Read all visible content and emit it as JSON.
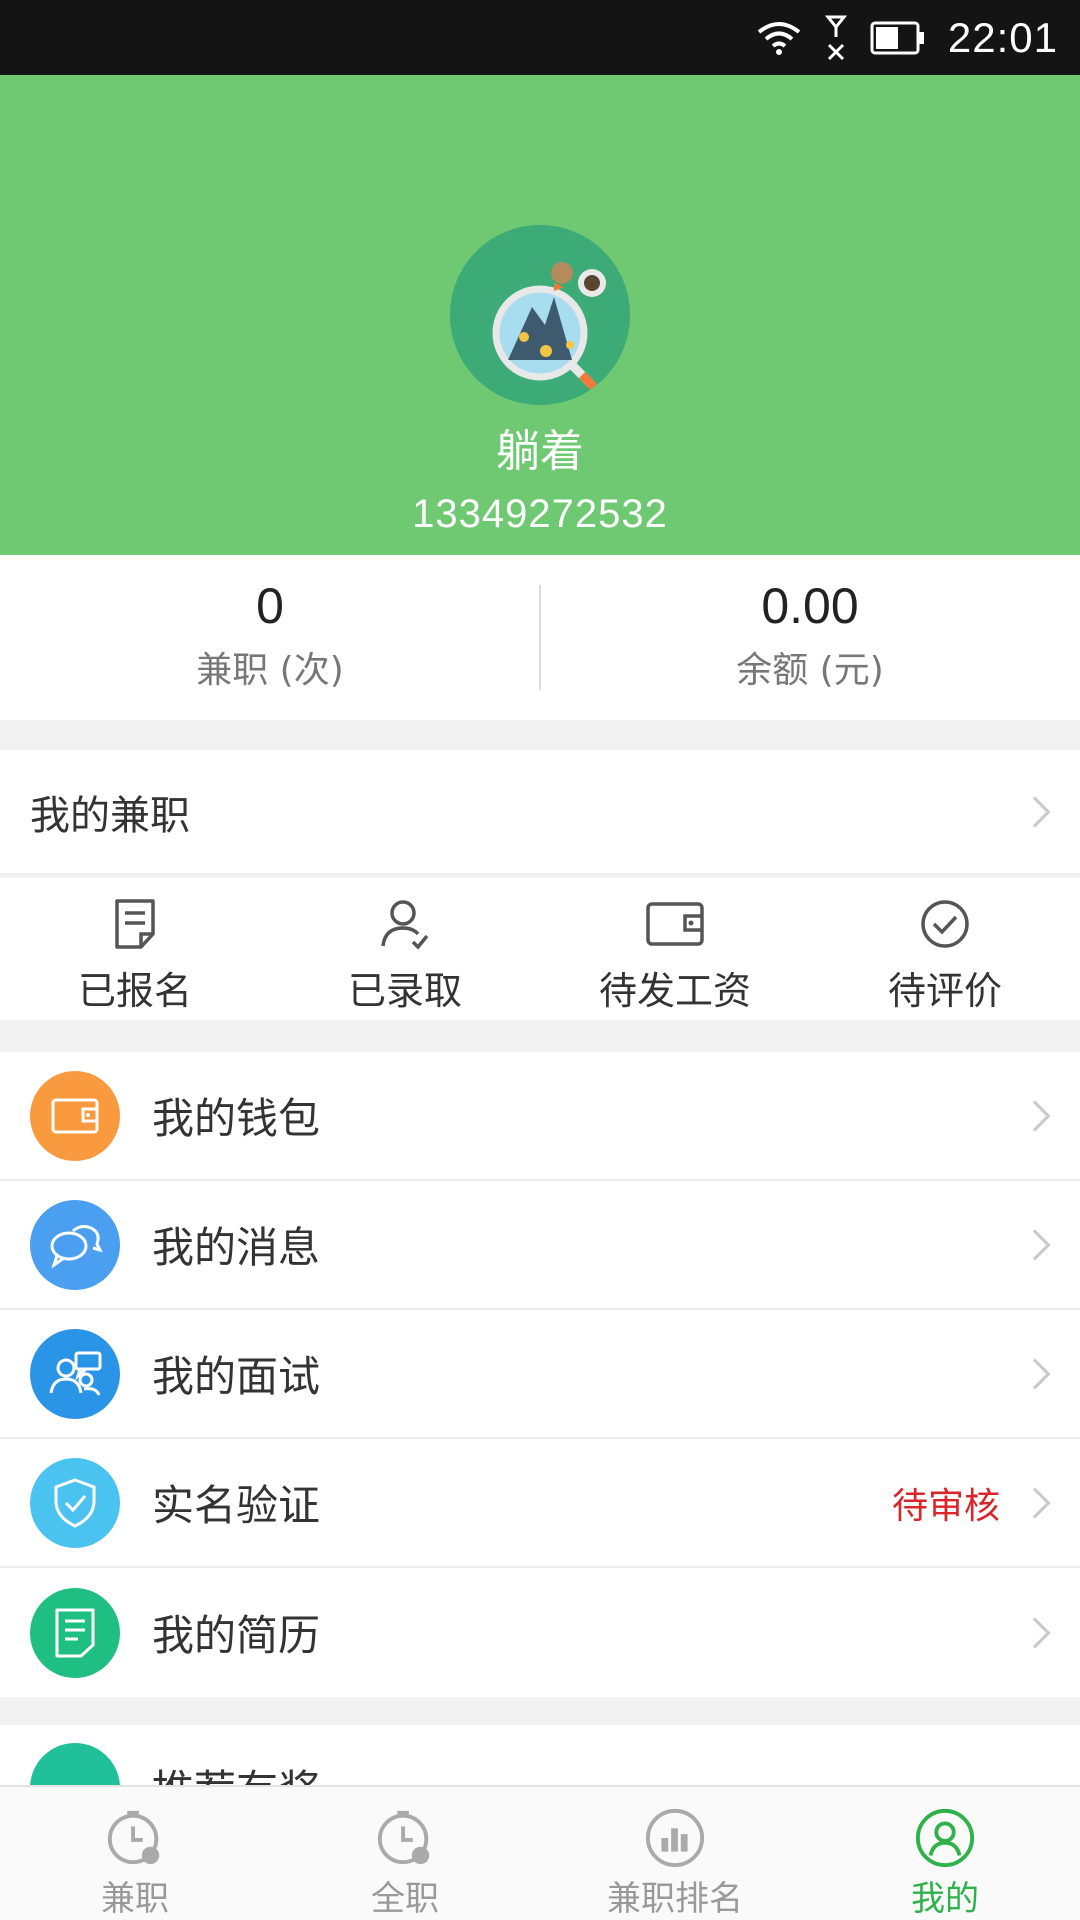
{
  "status_bar": {
    "time": "22:01"
  },
  "profile": {
    "name": "躺着",
    "phone": "13349272532"
  },
  "stats": [
    {
      "value": "0",
      "label": "兼职 (次)"
    },
    {
      "value": "0.00",
      "label": "余额 (元)"
    }
  ],
  "my_parttime": {
    "title": "我的兼职"
  },
  "shortcuts": [
    {
      "label": "已报名",
      "icon": "registration-icon"
    },
    {
      "label": "已录取",
      "icon": "admitted-user-icon"
    },
    {
      "label": "待发工资",
      "icon": "wallet-icon"
    },
    {
      "label": "待评价",
      "icon": "check-circle-icon"
    }
  ],
  "menu": [
    {
      "label": "我的钱包",
      "icon": "wallet-icon",
      "color": "#f89a3d"
    },
    {
      "label": "我的消息",
      "icon": "chat-bubbles-icon",
      "color": "#4a9ff0"
    },
    {
      "label": "我的面试",
      "icon": "interview-people-icon",
      "color": "#2a95e6"
    },
    {
      "label": "实名验证",
      "icon": "shield-check-icon",
      "color": "#4bc3f0",
      "badge": "待审核"
    },
    {
      "label": "我的简历",
      "icon": "resume-document-icon",
      "color": "#1fbf84"
    }
  ],
  "partial_item": {
    "label": "推荐有奖",
    "icon": "share-icon",
    "color": "#1fc09a"
  },
  "tabs": [
    {
      "label": "兼职",
      "icon": "parttime-clock-icon",
      "active": false
    },
    {
      "label": "全职",
      "icon": "fulltime-clock-icon",
      "active": false
    },
    {
      "label": "兼职排名",
      "icon": "ranking-icon",
      "active": false
    },
    {
      "label": "我的",
      "icon": "profile-icon",
      "active": true
    }
  ],
  "colors": {
    "header": "#6fc872",
    "active_tab": "#2fb24a",
    "badge": "#d9262b"
  }
}
